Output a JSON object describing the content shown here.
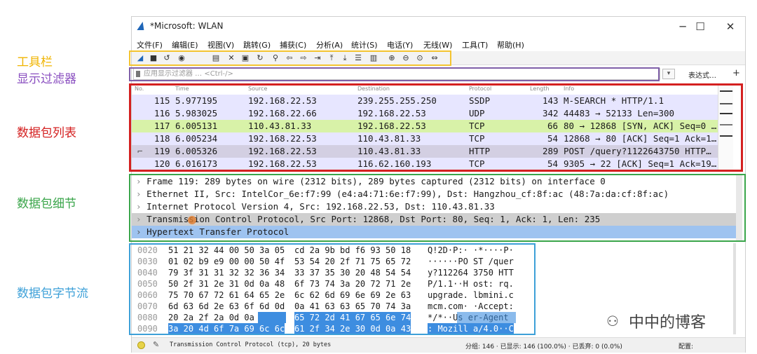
{
  "annotations": {
    "toolbar": "工具栏",
    "display_filter": "显示过滤器",
    "packet_list": "数据包列表",
    "packet_details": "数据包细节",
    "packet_bytes": "数据包字节流"
  },
  "colors": {
    "toolbar_box": "#f4c430",
    "filter_box": "#7f5fa8",
    "list_box": "#d42020",
    "detail_box": "#3aa54a",
    "bytes_box": "#3da0d8",
    "row_blue": "#e7e6ff",
    "row_green": "#e4ffc7",
    "row_selected": "#c8c3dc",
    "row_http": "#e4ffc7",
    "detail_selected_gray": "#cfcfcf",
    "detail_selected_blue": "#9ec3f0",
    "bytes_highlight": "#3d8de0"
  },
  "window": {
    "title": "*Microsoft: WLAN",
    "minimize": "─",
    "maximize": "☐",
    "close": "✕"
  },
  "menu": [
    "文件(F)",
    "编辑(E)",
    "视图(V)",
    "跳转(G)",
    "捕获(C)",
    "分析(A)",
    "统计(S)",
    "电话(Y)",
    "无线(W)",
    "工具(T)",
    "帮助(H)"
  ],
  "filter": {
    "placeholder": "应用显示过滤器 … <Ctrl-/>",
    "expression_label": "表达式…",
    "plus": "+"
  },
  "packet_list": {
    "headers": [
      "No.",
      "Time",
      "Source",
      "Destination",
      "Protocol",
      "Length",
      "Info"
    ],
    "rows": [
      {
        "no": "115",
        "time": "5.977195",
        "src": "192.168.22.53",
        "dst": "239.255.255.250",
        "proto": "SSDP",
        "len": "143",
        "info": "M-SEARCH * HTTP/1.1"
      },
      {
        "no": "116",
        "time": "5.983025",
        "src": "192.168.22.66",
        "dst": "192.168.22.53",
        "proto": "UDP",
        "len": "342",
        "info": "44483 → 52133 Len=300"
      },
      {
        "no": "117",
        "time": "6.005131",
        "src": "110.43.81.33",
        "dst": "192.168.22.53",
        "proto": "TCP",
        "len": "66",
        "info": "80 → 12868 [SYN, ACK] Seq=0 …"
      },
      {
        "no": "118",
        "time": "6.005234",
        "src": "192.168.22.53",
        "dst": "110.43.81.33",
        "proto": "TCP",
        "len": "54",
        "info": "12868 → 80 [ACK] Seq=1 Ack=1…"
      },
      {
        "no": "119",
        "time": "6.005326",
        "src": "192.168.22.53",
        "dst": "110.43.81.33",
        "proto": "HTTP",
        "len": "289",
        "info": "POST /query?1122643750 HTTP…"
      },
      {
        "no": "120",
        "time": "6.016173",
        "src": "192.168.22.53",
        "dst": "116.62.160.193",
        "proto": "TCP",
        "len": "54",
        "info": "9305 → 22 [ACK] Seq=1 Ack=19…"
      }
    ]
  },
  "details": [
    "Frame 119: 289 bytes on wire (2312 bits), 289 bytes captured (2312 bits) on interface 0",
    "Ethernet II, Src: IntelCor_6e:f7:99 (e4:a4:71:6e:f7:99), Dst: Hangzhou_cf:8f:ac (48:7a:da:cf:8f:ac)",
    "Internet Protocol Version 4, Src: 192.168.22.53, Dst: 110.43.81.33",
    "Transmission Control Protocol, Src Port: 12868, Dst Port: 80, Seq: 1, Ack: 1, Len: 235",
    "Hypertext Transfer Protocol"
  ],
  "bytes": [
    {
      "off": "0020",
      "hex1": "51 21 32 44 00 50 3a 05",
      "hex2": "cd 2a 9b bd f6 93 50 18",
      "ascii": "Q!2D·P:· ·*····P·"
    },
    {
      "off": "0030",
      "hex1": "01 02 b9 e9 00 00 50 4f",
      "hex2": "53 54 20 2f 71 75 65 72",
      "ascii": "······PO ST /quer"
    },
    {
      "off": "0040",
      "hex1": "79 3f 31 31 32 32 36 34",
      "hex2": "33 37 35 30 20 48 54 54",
      "ascii": "y?112264 3750 HTT"
    },
    {
      "off": "0050",
      "hex1": "50 2f 31 2e 31 0d 0a 48",
      "hex2": "6f 73 74 3a 20 72 71 2e",
      "ascii": "P/1.1··H ost: rq."
    },
    {
      "off": "0060",
      "hex1": "75 70 67 72 61 64 65 2e",
      "hex2": "6c 62 6d 69 6e 69 2e 63",
      "ascii": "upgrade. lbmini.c"
    },
    {
      "off": "0070",
      "hex1": "6d 63 6d 2e 63 6f 6d 0d",
      "hex2": "0a 41 63 63 65 70 74 3a",
      "ascii": "mcm.com· ·Accept:"
    },
    {
      "off": "0080",
      "hex1": "20 2a 2f 2a 0d 0a 55 73",
      "hex2": "65 72 2d 41 67 65 6e 74",
      "ascii": " */*··Us er-Agent"
    },
    {
      "off": "0090",
      "hex1": "3a 20 4d 6f 7a 69 6c 6c",
      "hex2": "61 2f 34 2e 30 0d 0a 43",
      "ascii": ": Mozill a/4.0··C"
    }
  ],
  "status": {
    "left_text": "Transmission Control Protocol (tcp), 20 bytes",
    "stats": "分组: 146 · 已显示: 146 (100.0%) · 已丢弃: 0 (0.0%)",
    "profile": "配置:"
  },
  "watermark": "中中的博客"
}
